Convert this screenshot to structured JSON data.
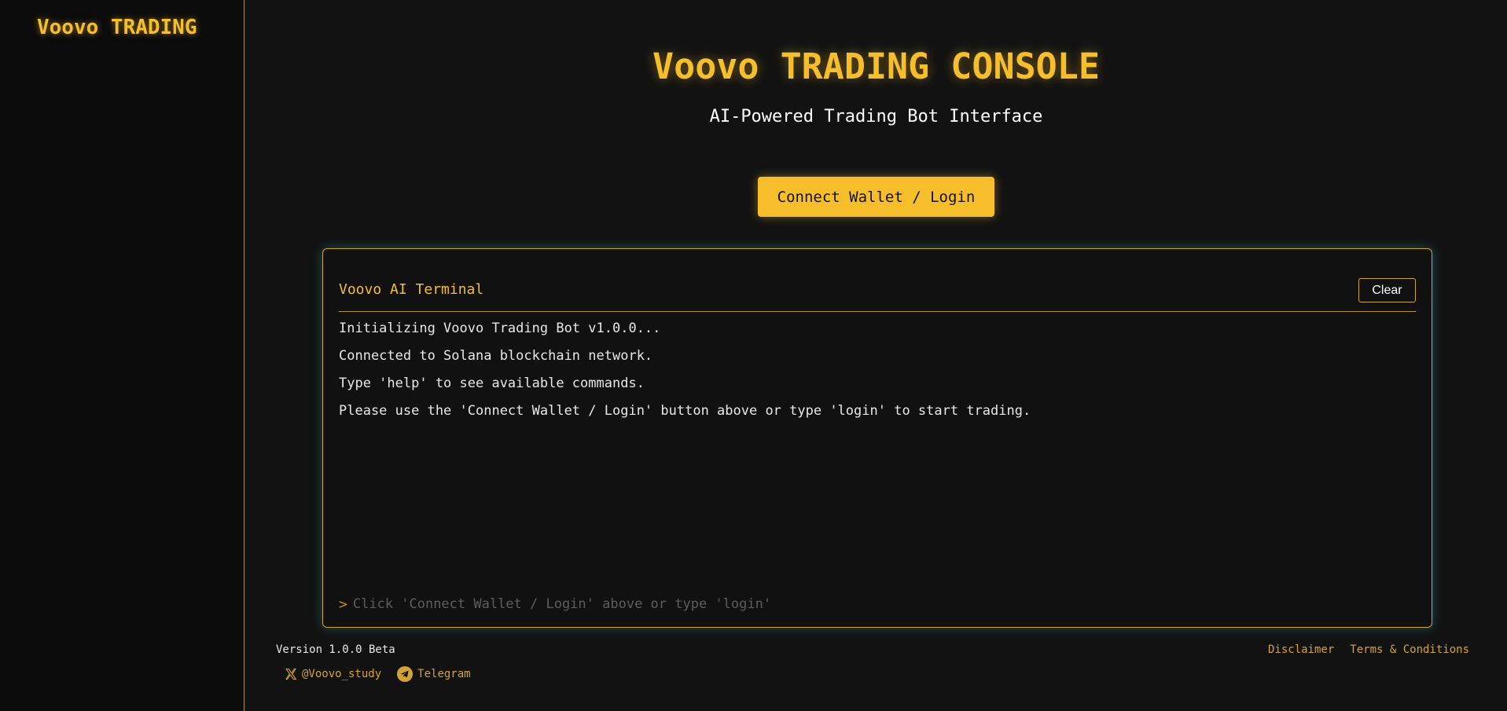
{
  "sidebar": {
    "brand": "Voovo TRADING"
  },
  "header": {
    "title": "Voovo TRADING CONSOLE",
    "subtitle": "AI-Powered Trading Bot Interface"
  },
  "actions": {
    "connect_label": "Connect Wallet / Login"
  },
  "terminal": {
    "title": "Voovo AI Terminal",
    "clear_label": "Clear",
    "lines": [
      "Initializing Voovo Trading Bot v1.0.0...",
      "Connected to Solana blockchain network.",
      "Type 'help' to see available commands.",
      "Please use the 'Connect Wallet / Login' button above or type 'login' to start trading."
    ],
    "prompt_symbol": ">",
    "input_value": "",
    "input_placeholder": "Click 'Connect Wallet / Login' above or type 'login'"
  },
  "footer": {
    "version": "Version 1.0.0 Beta",
    "social": [
      {
        "icon": "x-icon",
        "label": "@Voovo_study"
      },
      {
        "icon": "telegram-icon",
        "label": "Telegram"
      }
    ],
    "links": [
      "Disclaimer",
      "Terms & Conditions"
    ]
  },
  "colors": {
    "accent": "#f7be2c",
    "background": "#121212",
    "sidebar_background": "#0c0c0c",
    "text": "#e8e8e8",
    "glow": "#32c8dc"
  }
}
